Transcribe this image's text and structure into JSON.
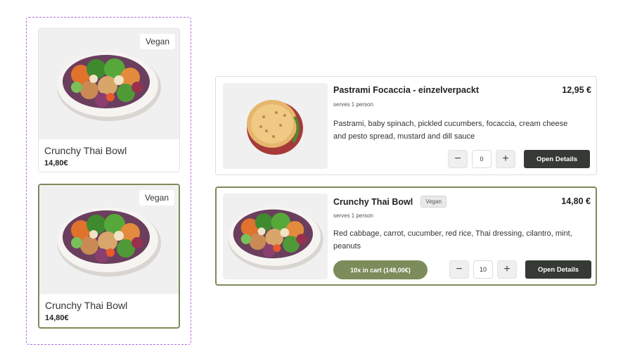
{
  "variants": [
    {
      "tag": "Vegan",
      "name": "Crunchy Thai Bowl",
      "price": "14,80€",
      "selected": false
    },
    {
      "tag": "Vegan",
      "name": "Crunchy Thai Bowl",
      "price": "14,80€",
      "selected": true
    }
  ],
  "items": [
    {
      "title": "Pastrami Focaccia - einzelverpackt",
      "price": "12,95 €",
      "serves": "serves 1 person",
      "description": "Pastrami, baby spinach, pickled cucumbers, focaccia, cream cheese and pesto spread, mustard and dill sauce",
      "quantity": "0",
      "minus": "−",
      "plus": "+",
      "details_label": "Open Details"
    },
    {
      "title": "Crunchy Thai Bowl",
      "badge": "Vegan",
      "price": "14,80 €",
      "serves": "serves 1 person",
      "description": "Red cabbage, carrot, cucumber, red rice, Thai dressing, cilantro, mint, peanuts",
      "cart_label": "10x in cart (148,00€)",
      "quantity": "10",
      "minus": "−",
      "plus": "+",
      "details_label": "Open Details"
    }
  ],
  "colors": {
    "accent": "#7c8c5a",
    "dark_button": "#353a35",
    "variant_frame": "#b56ae0"
  }
}
